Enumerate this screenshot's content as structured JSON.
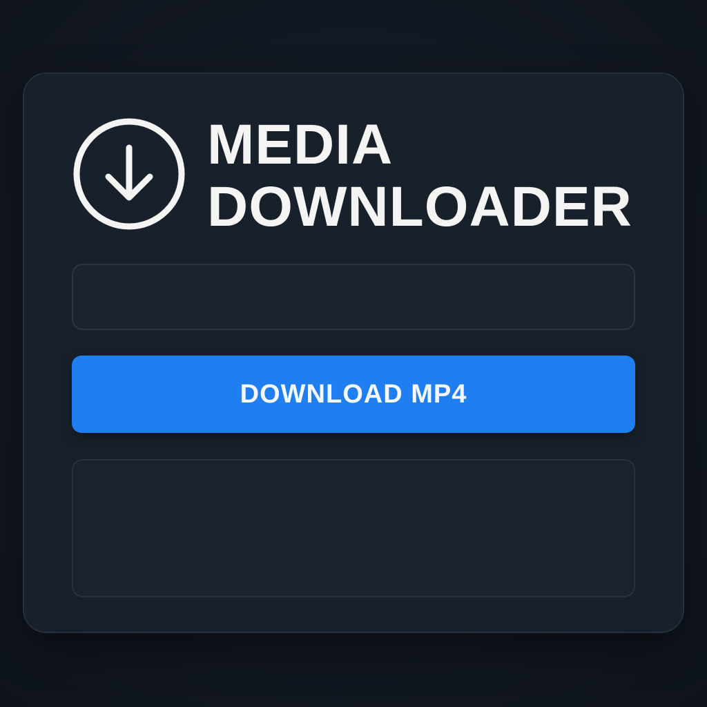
{
  "app": {
    "title_line1": "MEDIA",
    "title_line2": "DOWNLOADER",
    "icon": "download-circle-icon"
  },
  "form": {
    "url_value": "",
    "url_placeholder": "",
    "download_label": "DOWNLOAD MP4",
    "output_text": ""
  },
  "colors": {
    "background": "#121821",
    "panel": "#18212b",
    "accent": "#1f7ff0",
    "text": "#f4f4f2"
  }
}
